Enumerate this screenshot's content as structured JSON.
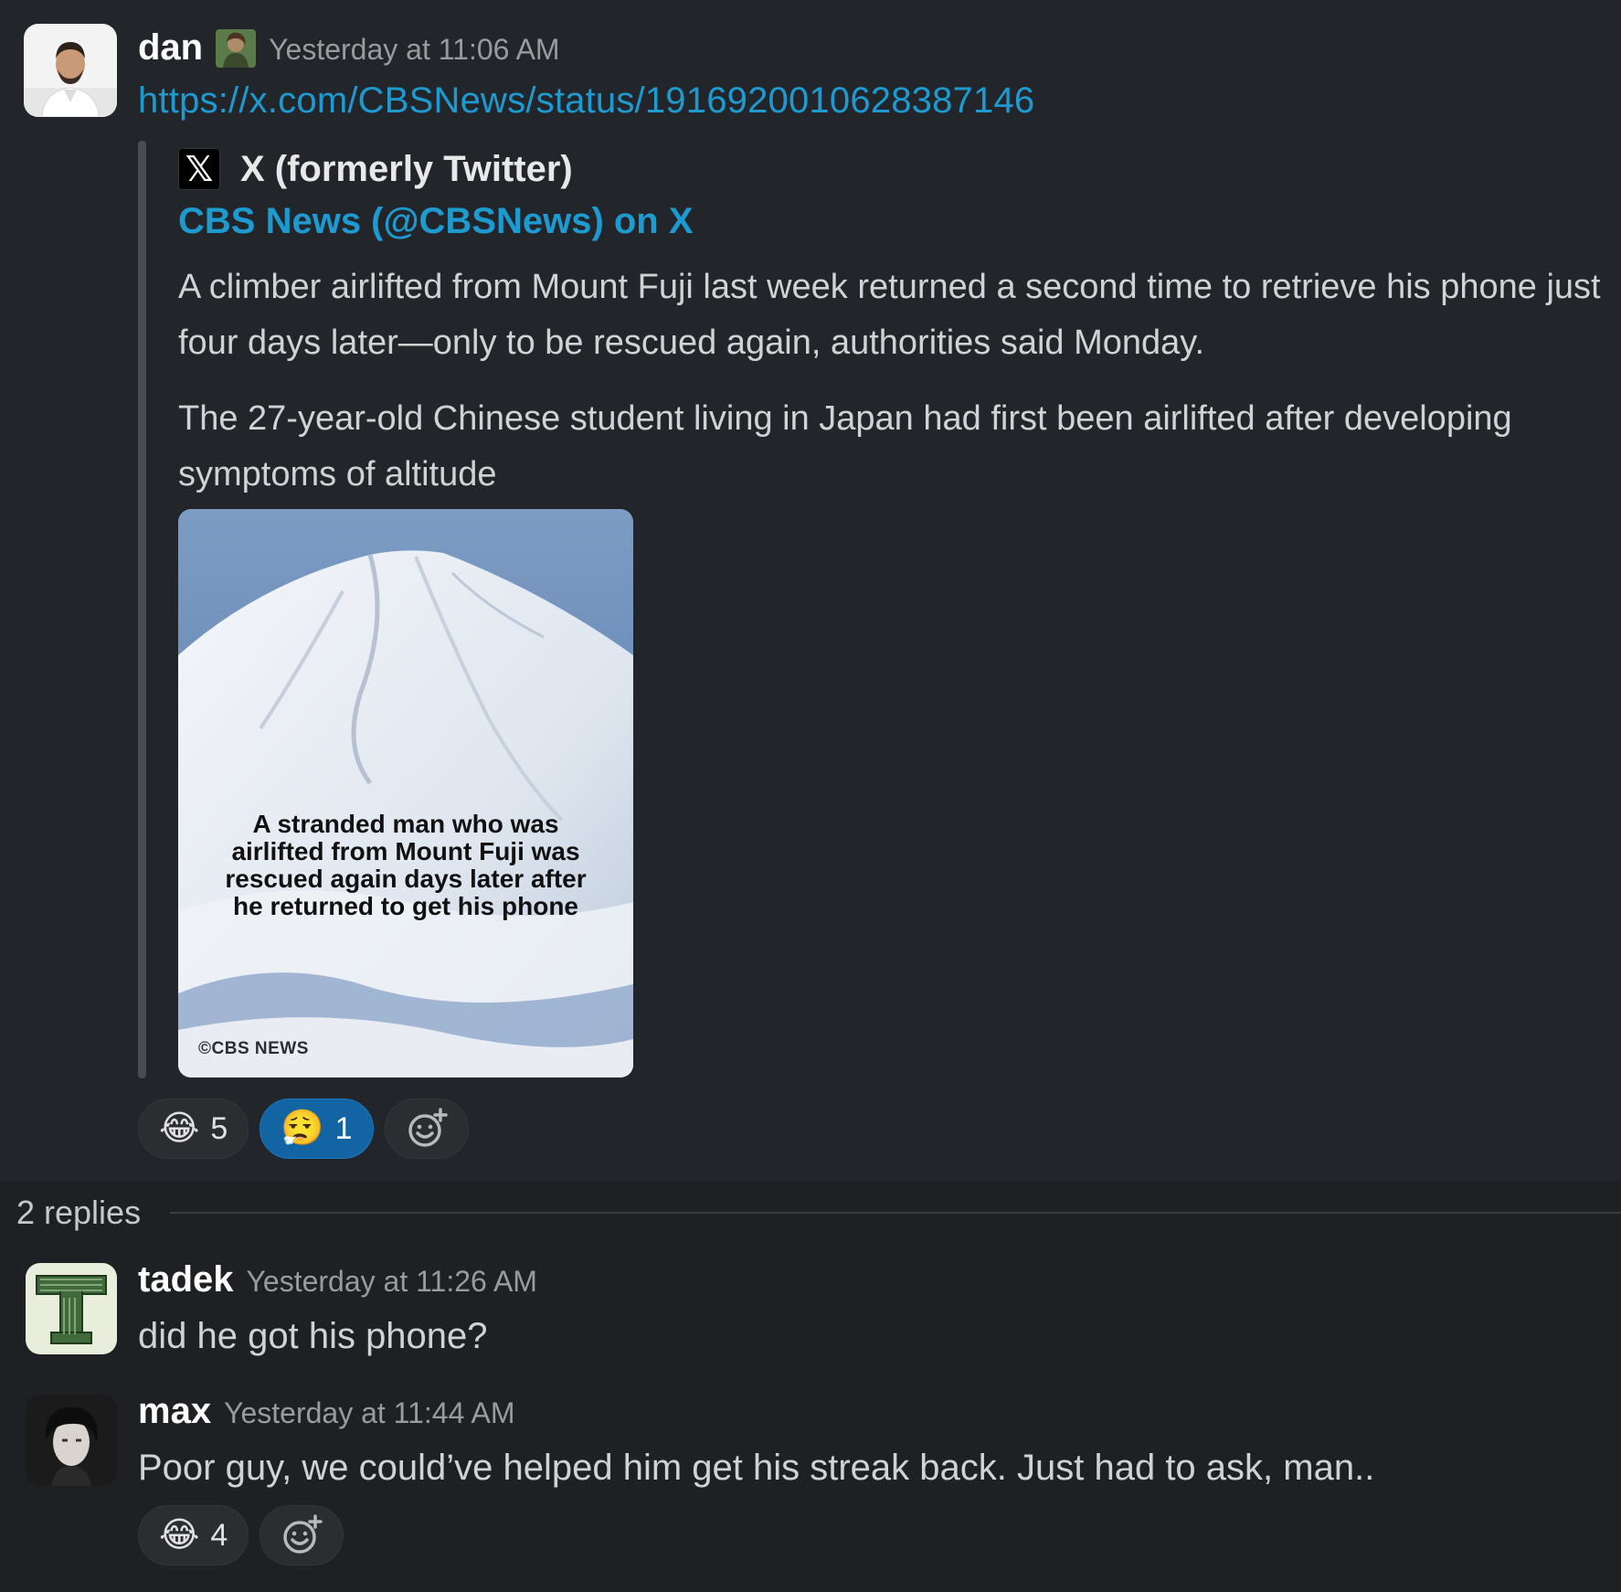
{
  "message": {
    "author": "dan",
    "timestamp": "Yesterday at 11:06 AM",
    "link": "https://x.com/CBSNews/status/1916920010628387146",
    "unfurl": {
      "service": "X (formerly Twitter)",
      "service_icon": "x-logo-icon",
      "title": "CBS News (@CBSNews) on X",
      "paragraphs": [
        "A climber airlifted from Mount Fuji last week  returned a second time to retrieve his phone just four days later—only to be rescued again, authorities said Monday.",
        "The 27-year-old Chinese student living in Japan had first been airlifted after developing symptoms of altitude"
      ],
      "image_caption": "A stranded man who was\nairlifted from Mount Fuji was\nrescued again days later after\nhe returned to get his phone",
      "image_watermark": "©CBS NEWS"
    },
    "reactions": [
      {
        "emoji": "😂",
        "count": "5",
        "active": false
      },
      {
        "emoji": "😮‍💨",
        "count": "1",
        "active": true
      }
    ]
  },
  "thread": {
    "replies_label": "2 replies",
    "replies": [
      {
        "author": "tadek",
        "timestamp": "Yesterday at 11:26 AM",
        "text": "did he got his phone?"
      },
      {
        "author": "max",
        "timestamp": "Yesterday at 11:44 AM",
        "text": "Poor guy, we could’ve helped him get his streak back. Just had to ask, man..",
        "reactions": [
          {
            "emoji": "😂",
            "count": "4"
          }
        ]
      }
    ]
  },
  "colors": {
    "link": "#1d9bd1",
    "active_reaction": "#1264a3",
    "background": "#1f2024"
  }
}
